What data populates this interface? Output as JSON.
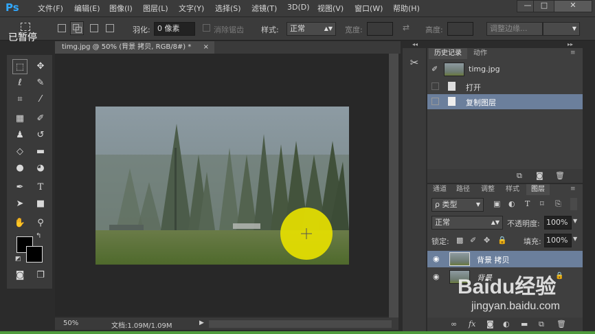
{
  "app": {
    "logo": "Ps"
  },
  "menu": [
    "文件(F)",
    "编辑(E)",
    "图像(I)",
    "图层(L)",
    "文字(Y)",
    "选择(S)",
    "滤镜(T)",
    "3D(D)",
    "视图(V)",
    "窗口(W)",
    "帮助(H)"
  ],
  "window_buttons": [
    "—",
    "□",
    "✕"
  ],
  "overlay_text": "已暂停",
  "options": {
    "feather_label": "羽化:",
    "feather_value": "0 像素",
    "antialias_label": "消除锯齿",
    "style_label": "样式:",
    "style_value": "正常",
    "width_label": "宽度:",
    "height_label": "高度:",
    "refine_edge": "调整边缘..."
  },
  "document": {
    "tab_title": "timg.jpg @ 50% (背景 拷贝, RGB/8#) *",
    "tab_close": "×",
    "zoom": "50%",
    "doc_size": "文档:1.09M/1.09M"
  },
  "history": {
    "tabs": [
      "历史记录",
      "动作"
    ],
    "snapshot": "timg.jpg",
    "items": [
      "打开",
      "复制图层"
    ]
  },
  "layers": {
    "tabs": [
      "通道",
      "路径",
      "调整",
      "样式",
      "图层"
    ],
    "filter_type": "ρ 类型",
    "blend_mode": "正常",
    "opacity_label": "不透明度:",
    "opacity_value": "100%",
    "lock_label": "锁定:",
    "fill_label": "填充:",
    "fill_value": "100%",
    "rows": [
      "背景 拷贝",
      "背景"
    ]
  },
  "watermark": {
    "brand": "Baidu经验",
    "url": "jingyan.baidu.com"
  },
  "colors": {
    "accent_blue": "#31a8ff",
    "selection": "#6b7f9c",
    "cursor_highlight": "#e6e000"
  }
}
